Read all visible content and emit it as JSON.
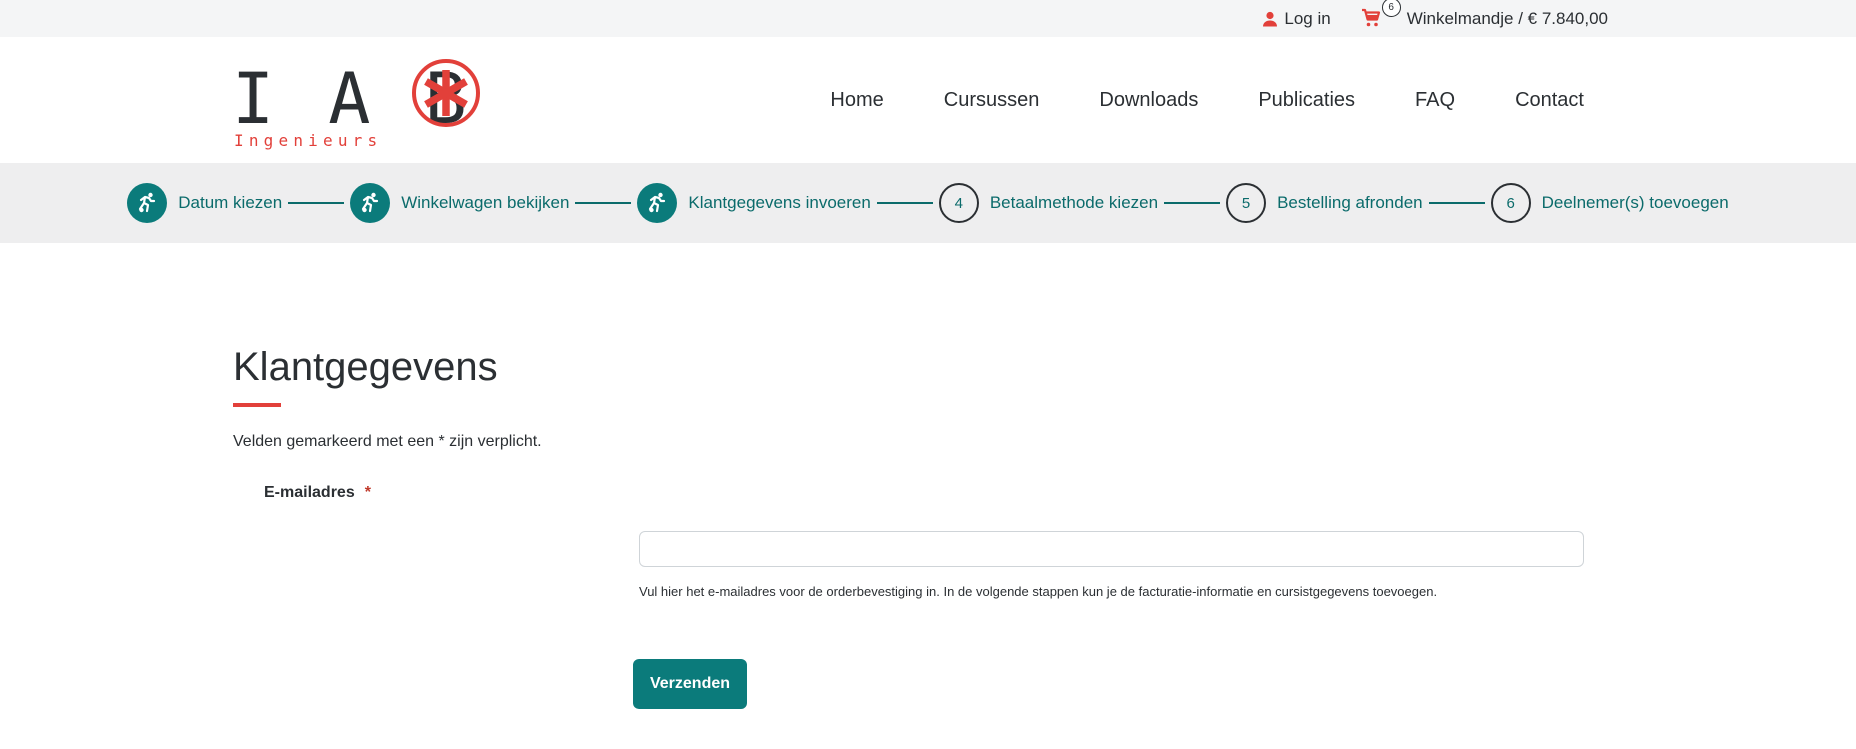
{
  "topbar": {
    "login_label": "Log in",
    "cart_count": "6",
    "cart_label": "Winkelmandje / € 7.840,00"
  },
  "logo": {
    "letters": "I A B",
    "subtitle": "Ingenieurs"
  },
  "nav": {
    "items": [
      {
        "label": "Home"
      },
      {
        "label": "Cursussen"
      },
      {
        "label": "Downloads"
      },
      {
        "label": "Publicaties"
      },
      {
        "label": "FAQ"
      },
      {
        "label": "Contact"
      }
    ]
  },
  "steps": [
    {
      "label": "Datum kiezen",
      "number": "",
      "done": true
    },
    {
      "label": "Winkelwagen bekijken",
      "number": "",
      "done": true
    },
    {
      "label": "Klantgegevens invoeren",
      "number": "",
      "done": true
    },
    {
      "label": "Betaalmethode kiezen",
      "number": "4",
      "done": false
    },
    {
      "label": "Bestelling afronden",
      "number": "5",
      "done": false
    },
    {
      "label": "Deelnemer(s) toevoegen",
      "number": "6",
      "done": false
    }
  ],
  "form": {
    "title": "Klantgegevens",
    "required_note": "Velden gemarkeerd met een * zijn verplicht.",
    "email_label": "E-mailadres",
    "required_marker": "*",
    "email_value": "",
    "email_placeholder": "",
    "help_text": "Vul hier het e-mailadres voor de orderbevestiging in. In de volgende stappen kun je de facturatie-informatie en cursistgegevens toevoegen.",
    "submit_label": "Verzenden"
  },
  "colors": {
    "accent": "#0b7b7b",
    "brand_red": "#e2403a",
    "text": "#2b2f33",
    "topbar_bg": "#f4f5f6",
    "steps_bg": "#eeeeef"
  },
  "icons": {
    "login": "person-icon",
    "cart": "shopping-cart-icon",
    "step_done": "running-person-icon",
    "logo_mark": "asterisk-circle-icon"
  }
}
